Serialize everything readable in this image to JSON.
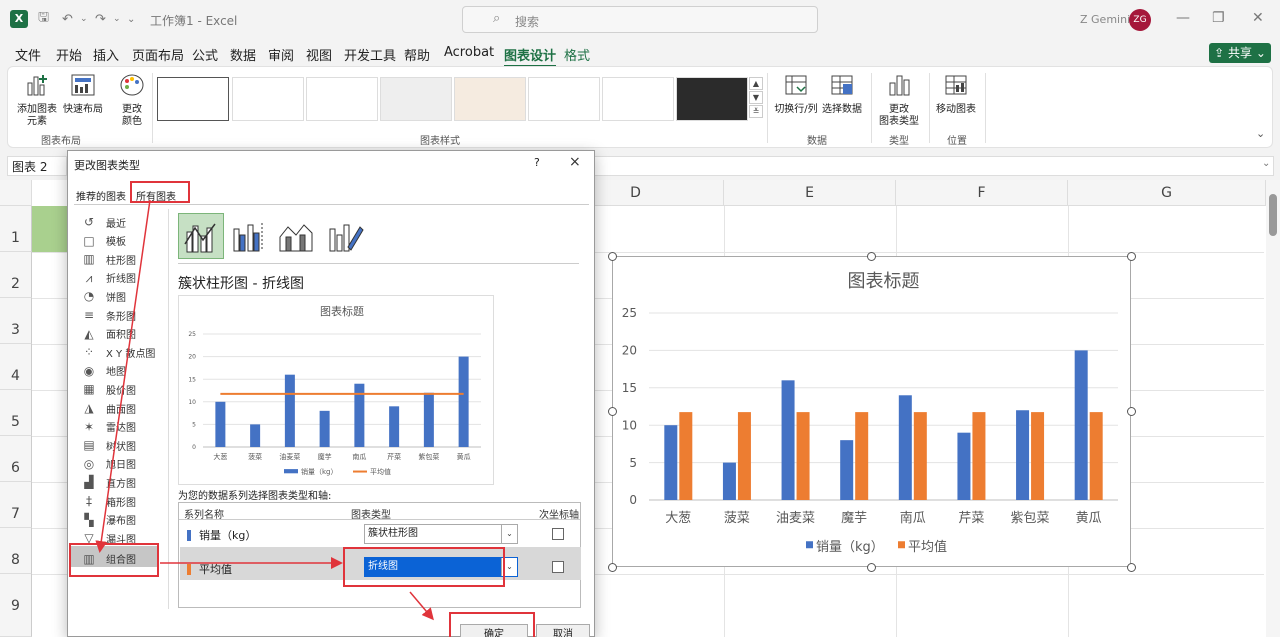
{
  "titlebar": {
    "app_letter": "X",
    "title": "工作簿1 - Excel",
    "search_placeholder": "搜索",
    "user_name": "Z Gemini",
    "user_initials": "ZG"
  },
  "menu": {
    "items": [
      "文件",
      "开始",
      "插入",
      "页面布局",
      "公式",
      "数据",
      "审阅",
      "视图",
      "开发工具",
      "帮助",
      "Acrobat",
      "图表设计",
      "格式"
    ],
    "active": "图表设计",
    "share_label": "共享"
  },
  "ribbon": {
    "add_element": "添加图表\n元素",
    "quick_layout": "快速布局",
    "change_colors": "更改\n颜色",
    "group_layout": "图表布局",
    "group_styles": "图表样式",
    "switch_row_col": "切换行/列",
    "select_data": "选择数据",
    "group_data": "数据",
    "change_type": "更改\n图表类型",
    "group_type": "类型",
    "move_chart": "移动图表",
    "group_location": "位置"
  },
  "namebox": "图表 2",
  "columns": [
    "D",
    "E",
    "F",
    "G"
  ],
  "rows": [
    "1",
    "2",
    "3",
    "4",
    "5",
    "6",
    "7",
    "8",
    "9"
  ],
  "dialog": {
    "title": "更改图表类型",
    "help": "?",
    "close": "×",
    "tabs": [
      "推荐的图表",
      "所有图表"
    ],
    "categories": [
      "最近",
      "模板",
      "柱形图",
      "折线图",
      "饼图",
      "条形图",
      "面积图",
      "X Y 散点图",
      "地图",
      "股价图",
      "曲面图",
      "雷达图",
      "树状图",
      "旭日图",
      "直方图",
      "箱形图",
      "瀑布图",
      "漏斗图",
      "组合图"
    ],
    "category_icons": [
      "↺",
      "□",
      "▥",
      "⩘",
      "◔",
      "≡",
      "◭",
      "⁘",
      "◉",
      "▦",
      "◮",
      "✶",
      "▤",
      "◎",
      "▟",
      "‡",
      "▚",
      "▽",
      "▥"
    ],
    "selected_category": "组合图",
    "subtype_title": "簇状柱形图 - 折线图",
    "series_prompt": "为您的数据系列选择图表类型和轴:",
    "table_headers": {
      "name": "系列名称",
      "type": "图表类型",
      "axis": "次坐标轴"
    },
    "series_rows": [
      {
        "name": "销量（kg）",
        "type": "簇状柱形图",
        "color": "#4472c4"
      },
      {
        "name": "平均值",
        "type": "折线图",
        "color": "#ed7d31"
      }
    ],
    "ok": "确定",
    "cancel": "取消"
  },
  "chart_data": {
    "type": "bar",
    "title": "图表标题",
    "categories": [
      "大葱",
      "菠菜",
      "油麦菜",
      "魔芋",
      "南瓜",
      "芹菜",
      "紫包菜",
      "黄瓜"
    ],
    "series": [
      {
        "name": "销量（kg）",
        "values": [
          10,
          5,
          16,
          8,
          14,
          9,
          12,
          20
        ],
        "color": "#4472c4"
      },
      {
        "name": "平均值",
        "values": [
          11.75,
          11.75,
          11.75,
          11.75,
          11.75,
          11.75,
          11.75,
          11.75
        ],
        "color": "#ed7d31"
      }
    ],
    "ylim": [
      0,
      25
    ],
    "yticks": [
      0,
      5,
      10,
      15,
      20,
      25
    ],
    "grid": true,
    "legend": "bottom"
  }
}
